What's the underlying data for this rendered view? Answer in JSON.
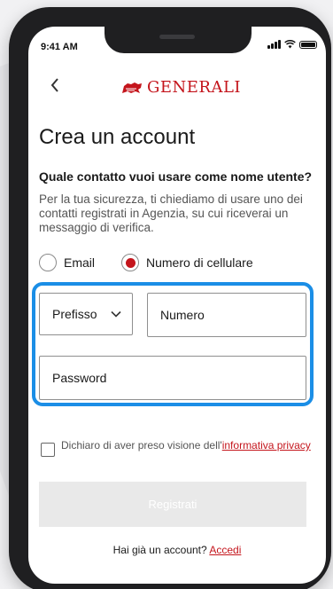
{
  "status_bar": {
    "time": "9:41 AM"
  },
  "header": {
    "logo_text": "GENERALI"
  },
  "form": {
    "title": "Crea un account",
    "question": "Quale contatto vuoi usare come nome utente?",
    "description": "Per la tua sicurezza, ti chiediamo di usare uno dei contatti registrati in Agenzia, su cui riceverai un messaggio di verifica.",
    "contact_options": [
      {
        "label": "Email",
        "selected": false
      },
      {
        "label": "Numero di cellulare",
        "selected": true
      }
    ],
    "prefix": {
      "label": "Prefisso"
    },
    "number": {
      "placeholder": "Numero"
    },
    "password": {
      "placeholder": "Password"
    },
    "consent": {
      "text": "Dichiaro di aver preso visione dell'",
      "link": "informativa privacy",
      "checked": false
    },
    "register_label": "Registrati",
    "login": {
      "text": "Hai già un account?",
      "link": "Accedi"
    }
  },
  "colors": {
    "brand_red": "#c4151c",
    "highlight_blue": "#1b8ee6",
    "disabled_button": "#e9e9e9"
  }
}
